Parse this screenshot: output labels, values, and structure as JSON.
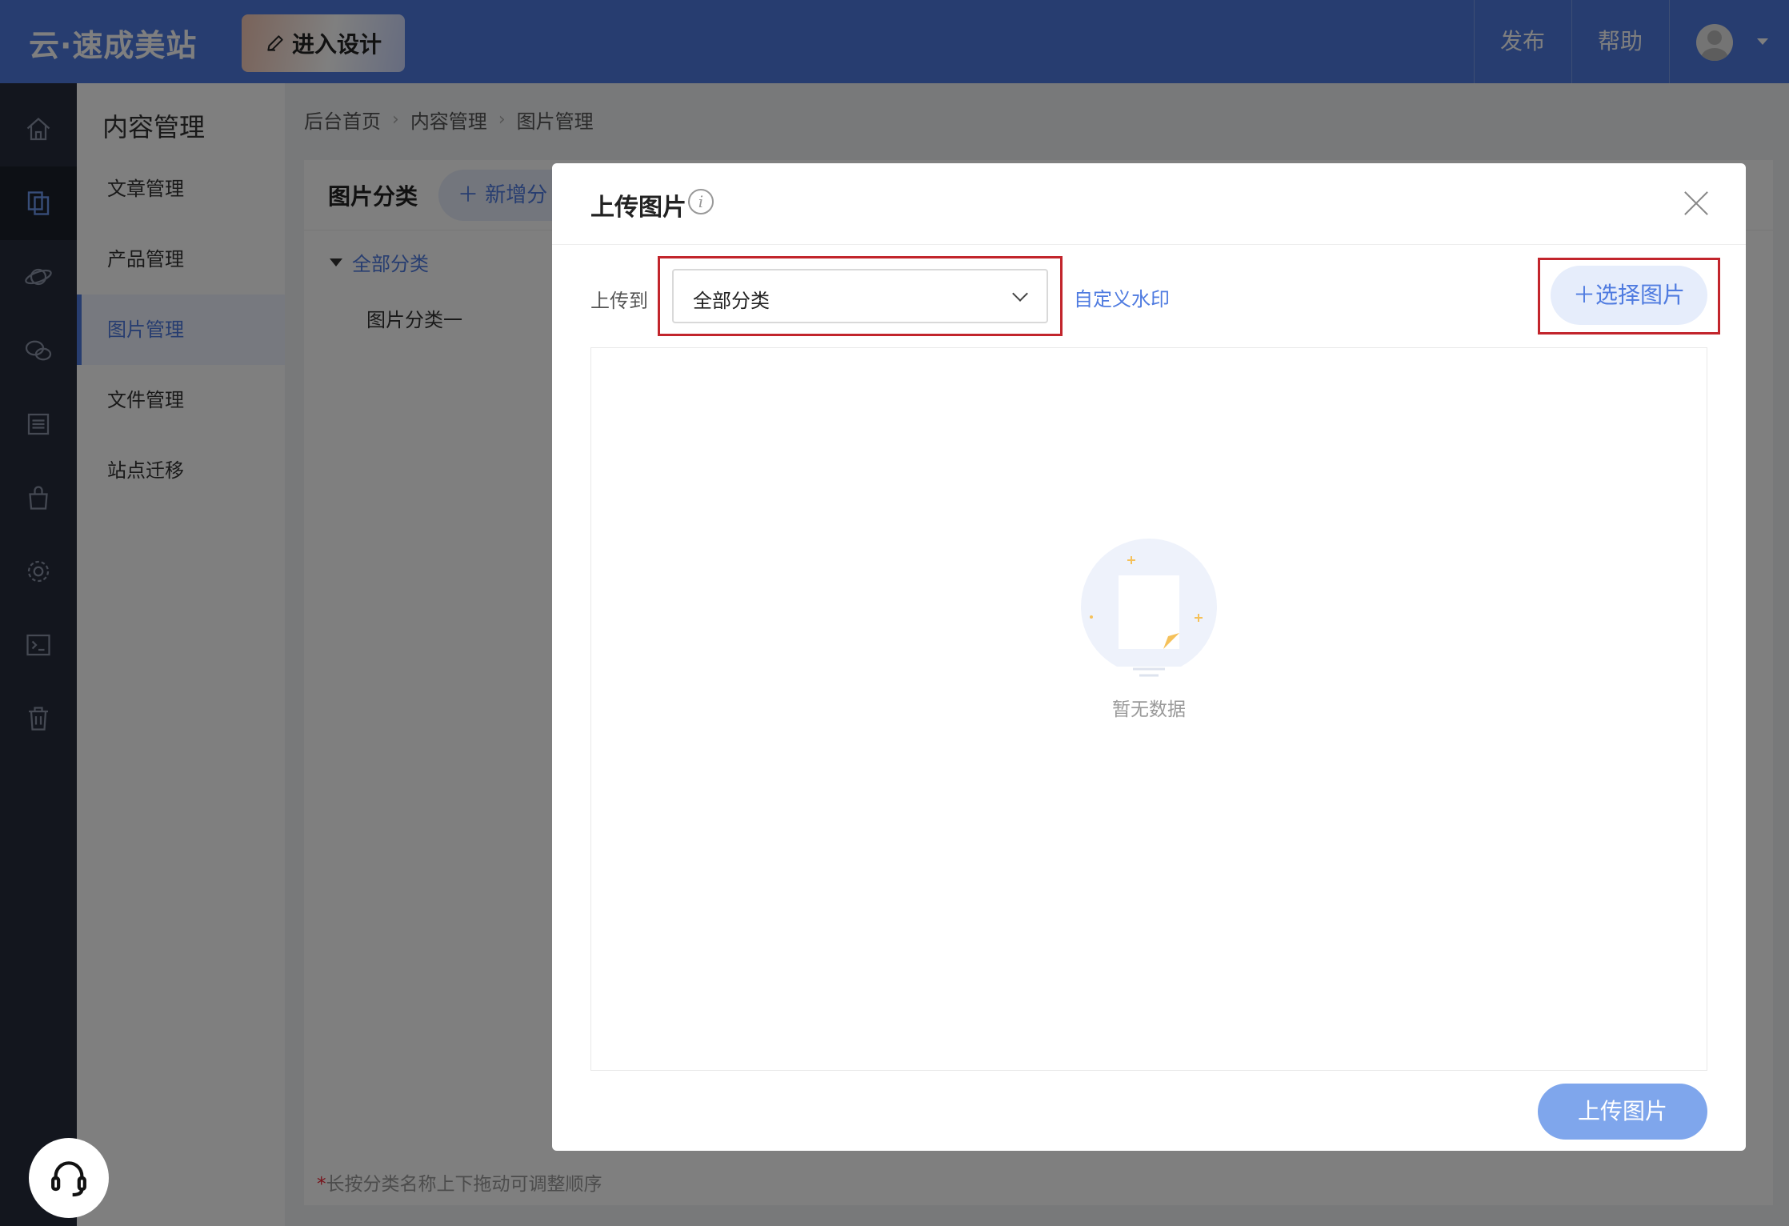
{
  "topbar": {
    "logo": "云·速成美站",
    "design_button": "进入设计",
    "publish": "发布",
    "help": "帮助",
    "accent": "#4f7be0"
  },
  "rail": {
    "icons": [
      "home-icon",
      "content-icon",
      "planet-icon",
      "chat-icon",
      "list-icon",
      "bag-icon",
      "settings-icon",
      "terminal-icon",
      "trash-icon"
    ],
    "active_index": 1,
    "background": "#262d3c"
  },
  "subnav": {
    "title": "内容管理",
    "items": [
      "文章管理",
      "产品管理",
      "图片管理",
      "文件管理",
      "站点迁移"
    ],
    "active_index": 2
  },
  "breadcrumb": [
    "后台首页",
    "内容管理",
    "图片管理"
  ],
  "panel": {
    "title": "图片分类",
    "add_category": "新增分",
    "category_all": "全部分类",
    "category_one": "图片分类一",
    "hint_star": "*",
    "hint": "长按分类名称上下拖动可调整顺序"
  },
  "modal": {
    "title": "上传图片",
    "upload_to_label": "上传到",
    "select_value": "全部分类",
    "watermark_link": "自定义水印",
    "choose_button": "选择图片",
    "empty_text": "暂无数据",
    "submit_button": "上传图片",
    "highlight_color": "#c2252c"
  }
}
